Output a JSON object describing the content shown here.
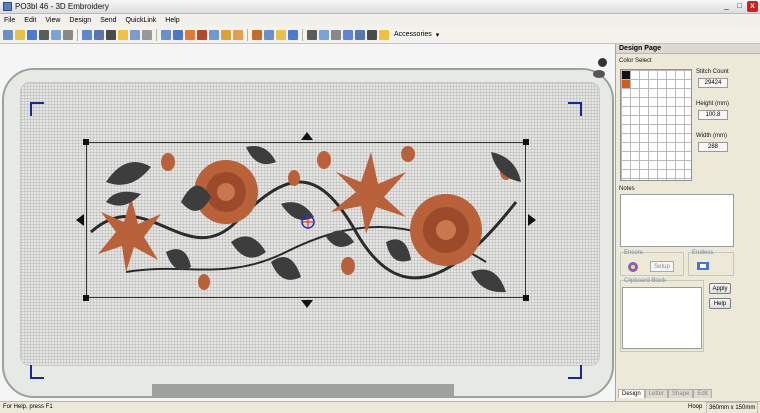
{
  "window": {
    "title": "PO3bl  46 - 3D Embroidery",
    "controls": [
      "_",
      "□",
      "x"
    ]
  },
  "menu": [
    "File",
    "Edit",
    "View",
    "Design",
    "Send",
    "QuickLink",
    "Help"
  ],
  "toolbar": {
    "accessories_label": "Accessories",
    "icon_colors": [
      "#6c8fc7",
      "#e6c24a",
      "#4a7bd1",
      "#5b5b5b",
      "#7ca3d9",
      "#888888",
      "#5f87d0",
      "#5577aa",
      "#4b4b4b",
      "#f0c040",
      "#7b9ccc",
      "#999999",
      "#6a8fd1",
      "#4f77c2",
      "#e07a3a",
      "#b04a2a",
      "#6c9bd2",
      "#d9a23a",
      "#e0a050",
      "#c76a2a"
    ]
  },
  "panel": {
    "title": "Design Page",
    "color_select_label": "Color Select",
    "swatches": [
      "#111111",
      "#d35a1c"
    ],
    "stitch_count_label": "Stitch Count",
    "stitch_count": "29424",
    "height_label": "Height (mm)",
    "height": "100.8",
    "width_label": "Width (mm)",
    "width": "288",
    "notes_label": "Notes",
    "encore_label": "Encore",
    "endless_label": "Endless",
    "setup_label": "Setup",
    "clipboard_label": "Clipboard Block",
    "apply_label": "Apply",
    "help_label": "Help",
    "tabs": [
      "Design",
      "Letter",
      "Shape",
      "Edit"
    ]
  },
  "status": {
    "help_text": "For Help, press F1",
    "hoop_label": "Hoop",
    "hoop_size": "360mm x 150mm"
  },
  "design_colors": {
    "rose": "#b8613a",
    "leaf": "#3d3d3d",
    "stem": "#2b2b2b"
  }
}
